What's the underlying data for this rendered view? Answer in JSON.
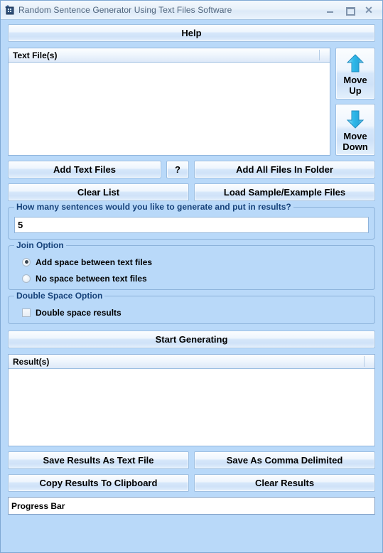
{
  "window": {
    "title": "Random Sentence Generator Using Text Files Software",
    "icon": "app-icon",
    "minimize": "–",
    "maximize": "▭",
    "close": "✕"
  },
  "help": {
    "label": "Help"
  },
  "files_list": {
    "header": "Text File(s)",
    "items": []
  },
  "move_buttons": {
    "up": "Move\nUp",
    "up_line1": "Move",
    "up_line2": "Up",
    "down_line1": "Move",
    "down_line2": "Down"
  },
  "actions": {
    "add_text_files": "Add Text Files",
    "help_question": "?",
    "add_all_files_in_folder": "Add All Files In Folder",
    "clear_list": "Clear List",
    "load_sample": "Load Sample/Example Files"
  },
  "sentences_group": {
    "title": "How many sentences would you like to generate and put in results?",
    "value": "5"
  },
  "join_option": {
    "title": "Join Option",
    "options": [
      {
        "label": "Add space between text files",
        "selected": true
      },
      {
        "label": "No space between text files",
        "selected": false
      }
    ]
  },
  "double_space_option": {
    "title": "Double Space Option",
    "checkbox_label": "Double space results",
    "checked": false
  },
  "start": {
    "label": "Start Generating"
  },
  "results_list": {
    "header": "Result(s)",
    "items": []
  },
  "bottom_actions": {
    "save_as_text": "Save Results As Text File",
    "save_comma": "Save As Comma Delimited",
    "copy_clipboard": "Copy Results To Clipboard",
    "clear_results": "Clear Results"
  },
  "progress": {
    "label": "Progress Bar"
  },
  "colors": {
    "background": "#b9d9f9",
    "group_title": "#16427a",
    "arrow": "#29b6e8",
    "title_text": "#50657d"
  }
}
